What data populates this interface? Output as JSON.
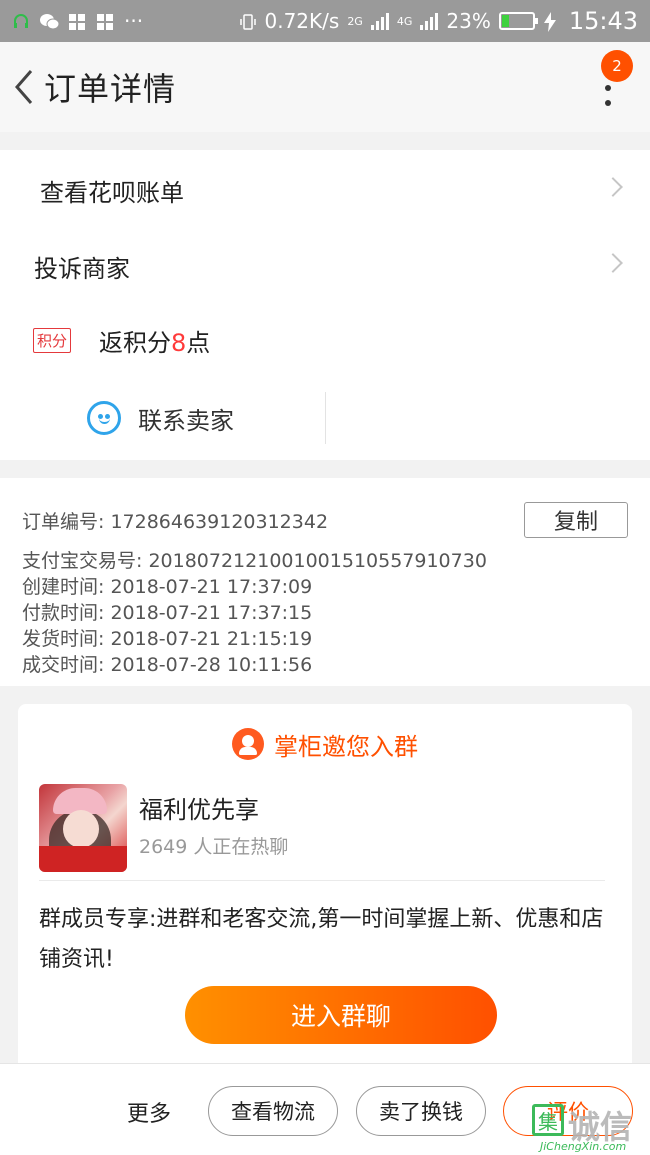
{
  "status_bar": {
    "speed": "0.72K/s",
    "net1": "2G",
    "net2": "4G",
    "battery_percent": "23%",
    "battery_level": 0.23,
    "time": "15:43",
    "more_dots": "···"
  },
  "nav": {
    "title": "订单详情",
    "badge": "2"
  },
  "links": {
    "huabei": "查看花呗账单",
    "complaint": "投诉商家"
  },
  "points": {
    "tag": "积分",
    "prefix": "返积分",
    "number": "8",
    "suffix": "点"
  },
  "contact": {
    "label": "联系卖家"
  },
  "order": {
    "number_line": "订单编号: 172864639120312342",
    "alipay_line": "支付宝交易号: 2018072121001001510557910730",
    "created_line": "创建时间: 2018-07-21 17:37:09",
    "paid_line": "付款时间: 2018-07-21 17:37:15",
    "shipped_line": "发货时间: 2018-07-21 21:15:19",
    "completed_line": "成交时间: 2018-07-28 10:11:56",
    "copy_label": "复制"
  },
  "group_card": {
    "header": "掌柜邀您入群",
    "group_name": "福利优先享",
    "member_count": "2649 人正在热聊",
    "description": "群成员专享:进群和老客交流,第一时间掌握上新、优惠和店铺资讯!",
    "join_label": "进入群聊"
  },
  "bottom_bar": {
    "more": "更多",
    "logistics": "查看物流",
    "sell_for_cash": "卖了换钱",
    "review": "评价"
  },
  "watermark": {
    "url": "JiChengXin.com"
  },
  "colors": {
    "accent": "#ff5000",
    "points_red": "#e4393c",
    "contact_blue": "#2fa4ea"
  }
}
